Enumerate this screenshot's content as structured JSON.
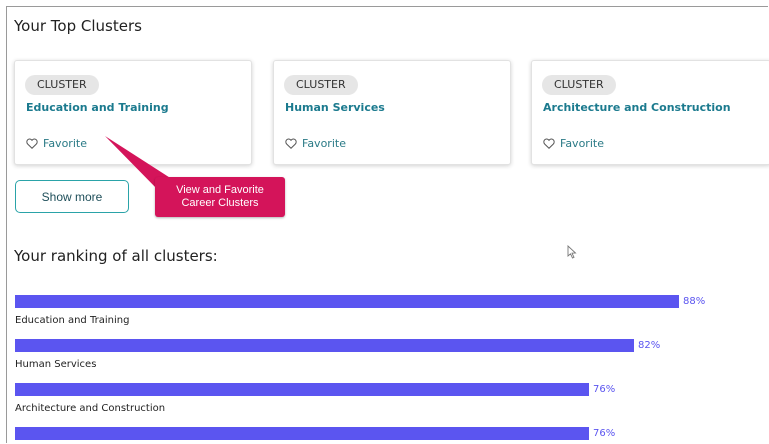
{
  "top_clusters": {
    "title": "Your Top Clusters",
    "cards": [
      {
        "tag": "CLUSTER",
        "name": "Education and Training",
        "favorite_label": "Favorite"
      },
      {
        "tag": "CLUSTER",
        "name": "Human Services",
        "favorite_label": "Favorite"
      },
      {
        "tag": "CLUSTER",
        "name": "Architecture and Construction",
        "favorite_label": "Favorite"
      }
    ],
    "show_more_label": "Show more"
  },
  "callout": {
    "line1": "View and Favorite",
    "line2": "Career Clusters",
    "color": "#d4145a"
  },
  "ranking": {
    "title": "Your ranking of all clusters:",
    "bar_color": "#5b55f0",
    "items": [
      {
        "label": "Education and Training",
        "percent": 88,
        "percent_text": "88%"
      },
      {
        "label": "Human Services",
        "percent": 82,
        "percent_text": "82%"
      },
      {
        "label": "Architecture and Construction",
        "percent": 76,
        "percent_text": "76%"
      },
      {
        "label": "",
        "percent": 76,
        "percent_text": "76%"
      }
    ]
  },
  "colors": {
    "accent_teal": "#1b7a8e",
    "button_border": "#2aa3a8"
  }
}
